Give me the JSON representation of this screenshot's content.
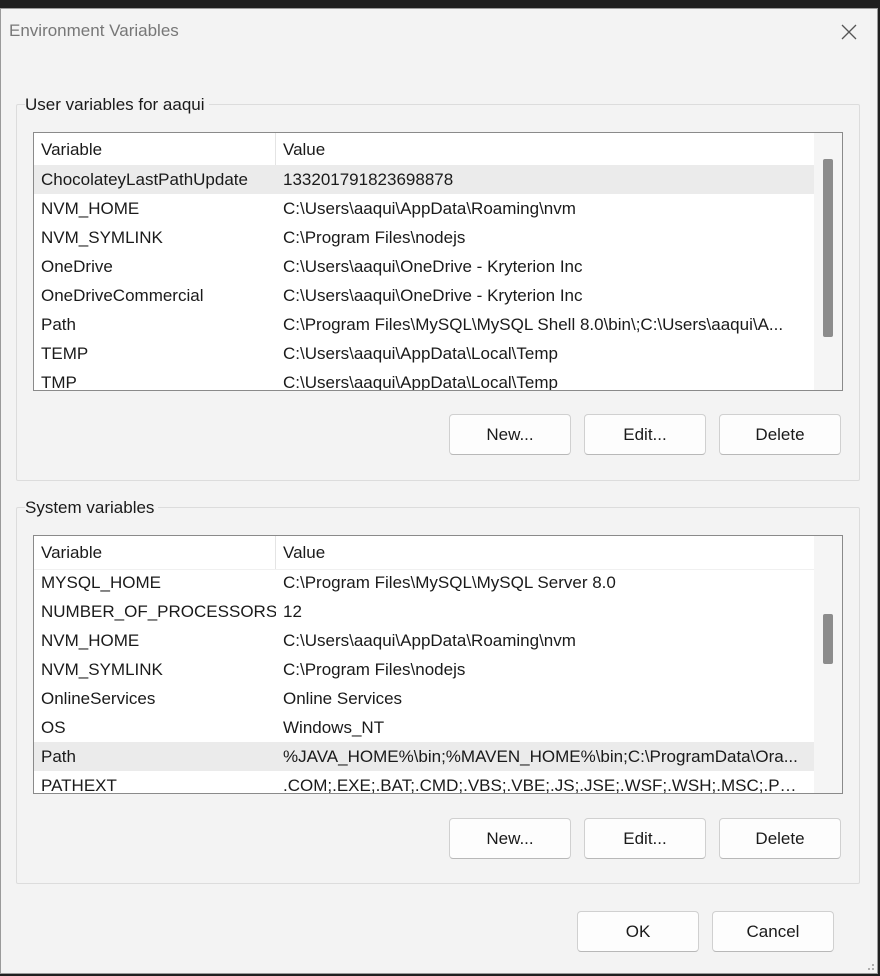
{
  "window": {
    "title": "Environment Variables"
  },
  "user_section": {
    "label": "User variables for aaqui",
    "columns": {
      "variable": "Variable",
      "value": "Value"
    },
    "rows": [
      {
        "variable": "ChocolateyLastPathUpdate",
        "value": "133201791823698878",
        "selected": true
      },
      {
        "variable": "NVM_HOME",
        "value": "C:\\Users\\aaqui\\AppData\\Roaming\\nvm"
      },
      {
        "variable": "NVM_SYMLINK",
        "value": "C:\\Program Files\\nodejs"
      },
      {
        "variable": "OneDrive",
        "value": "C:\\Users\\aaqui\\OneDrive - Kryterion Inc"
      },
      {
        "variable": "OneDriveCommercial",
        "value": "C:\\Users\\aaqui\\OneDrive - Kryterion Inc"
      },
      {
        "variable": "Path",
        "value": "C:\\Program Files\\MySQL\\MySQL Shell 8.0\\bin\\;C:\\Users\\aaqui\\A..."
      },
      {
        "variable": "TEMP",
        "value": "C:\\Users\\aaqui\\AppData\\Local\\Temp"
      },
      {
        "variable": "TMP",
        "value": "C:\\Users\\aaqui\\AppData\\Local\\Temp"
      }
    ],
    "buttons": {
      "new": "New...",
      "edit": "Edit...",
      "delete": "Delete"
    }
  },
  "system_section": {
    "label": "System variables",
    "columns": {
      "variable": "Variable",
      "value": "Value"
    },
    "rows": [
      {
        "variable": "MYSQL_HOME",
        "value": "C:\\Program Files\\MySQL\\MySQL Server 8.0"
      },
      {
        "variable": "NUMBER_OF_PROCESSORS",
        "value": "12"
      },
      {
        "variable": "NVM_HOME",
        "value": "C:\\Users\\aaqui\\AppData\\Roaming\\nvm"
      },
      {
        "variable": "NVM_SYMLINK",
        "value": "C:\\Program Files\\nodejs"
      },
      {
        "variable": "OnlineServices",
        "value": "Online Services"
      },
      {
        "variable": "OS",
        "value": "Windows_NT"
      },
      {
        "variable": "Path",
        "value": "%JAVA_HOME%\\bin;%MAVEN_HOME%\\bin;C:\\ProgramData\\Ora...",
        "selected": true
      },
      {
        "variable": "PATHEXT",
        "value": ".COM;.EXE;.BAT;.CMD;.VBS;.VBE;.JS;.JSE;.WSF;.WSH;.MSC;.PY;.PYW"
      }
    ],
    "buttons": {
      "new": "New...",
      "edit": "Edit...",
      "delete": "Delete"
    }
  },
  "footer": {
    "ok": "OK",
    "cancel": "Cancel"
  },
  "icons": {
    "close": "close-icon",
    "resize": "resize-grip-icon"
  },
  "colors": {
    "dialog_bg": "#f3f3f3",
    "selected_row": "#ebebeb",
    "scroll_thumb": "#8c8c8c"
  }
}
